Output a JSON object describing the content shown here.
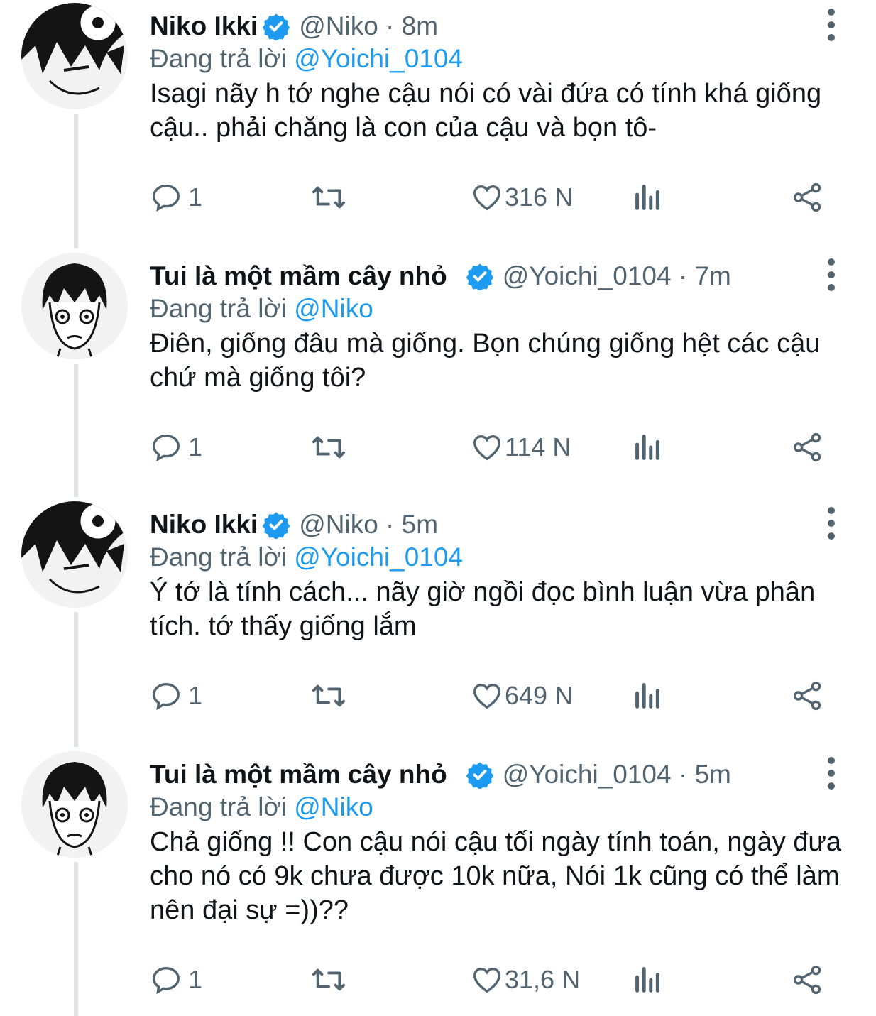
{
  "colors": {
    "accent": "#1d9bf0",
    "muted": "#536471",
    "text": "#0f1419",
    "thread_line": "#dfe3e6"
  },
  "reply_prefix": "Đang trả lời",
  "tweets": [
    {
      "name": "Niko Ikki",
      "handle": "@Niko · 8m",
      "reply_to": "@Yoichi_0104",
      "body": "Isagi nãy h tớ nghe cậu nói có vài đứa có tính khá giống cậu.. phải chăng là con của cậu và bọn tô-",
      "replies": "1",
      "likes": "316 N",
      "avatar": "niko-avatar"
    },
    {
      "name": "Tui là một mầm cây nhỏ",
      "handle": "@Yoichi_0104 · 7m",
      "reply_to": "@Niko",
      "body": "Điên, giống đâu mà giống. Bọn chúng giống hệt các cậu chứ mà giống tôi?",
      "replies": "1",
      "likes": "114 N",
      "avatar": "yoichi-avatar"
    },
    {
      "name": "Niko Ikki",
      "handle": "@Niko · 5m",
      "reply_to": "@Yoichi_0104",
      "body": "Ý tớ là tính cách... nãy giờ ngồi đọc bình luận vừa phân tích. tớ thấy giống lắm",
      "replies": "1",
      "likes": "649 N",
      "avatar": "niko-avatar"
    },
    {
      "name": "Tui là một mầm cây nhỏ",
      "handle": "@Yoichi_0104 · 5m",
      "reply_to": "@Niko",
      "body": "Chả giống !! Con cậu nói cậu tối ngày tính toán, ngày đưa cho nó có 9k chưa được 10k nữa, Nói 1k cũng có thể làm nên đại sự =))??",
      "replies": "1",
      "likes": "31,6 N",
      "avatar": "yoichi-avatar"
    }
  ]
}
